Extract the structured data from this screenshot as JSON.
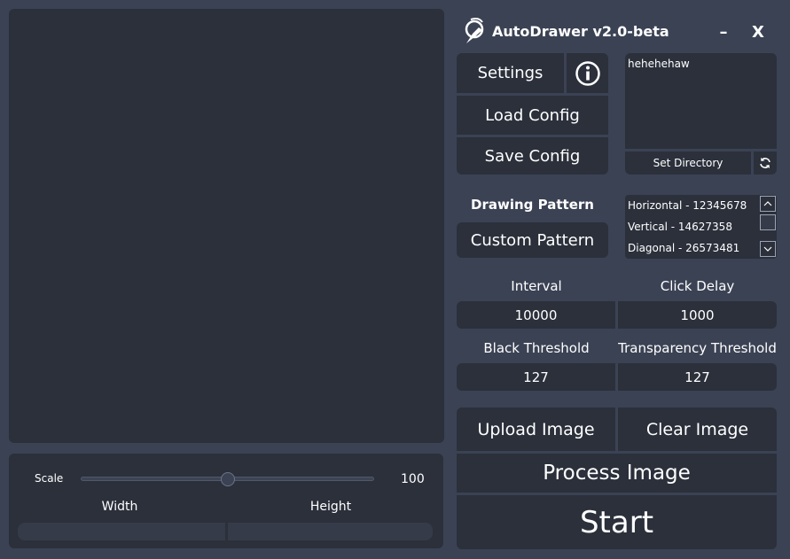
{
  "window": {
    "title": "AutoDrawer v2.0-beta",
    "minimize_label": "–",
    "close_label": "X"
  },
  "buttons": {
    "settings": "Settings",
    "load_config": "Load Config",
    "save_config": "Save Config",
    "custom_pattern": "Custom Pattern",
    "upload_image": "Upload Image",
    "clear_image": "Clear Image",
    "process_image": "Process Image",
    "start": "Start"
  },
  "directory": {
    "text": "hehehehaw",
    "set_label": "Set Directory"
  },
  "drawing_pattern": {
    "heading": "Drawing Pattern",
    "items": [
      "Horizontal - 12345678",
      "Vertical - 14627358",
      "Diagonal - 26573481"
    ]
  },
  "fields": {
    "interval": {
      "label": "Interval",
      "value": "10000"
    },
    "click_delay": {
      "label": "Click Delay",
      "value": "1000"
    },
    "black_threshold": {
      "label": "Black Threshold",
      "value": "127"
    },
    "transparency_threshold": {
      "label": "Transparency Threshold",
      "value": "127"
    }
  },
  "scale": {
    "label": "Scale",
    "value": "100",
    "fraction": 0.5
  },
  "size": {
    "width_label": "Width",
    "height_label": "Height"
  },
  "colors": {
    "background": "#3b4254",
    "panel": "#2b303b"
  },
  "icons": {
    "logo": "paint-brush-logo-icon",
    "info": "info-circle-icon",
    "refresh": "refresh-icon"
  }
}
